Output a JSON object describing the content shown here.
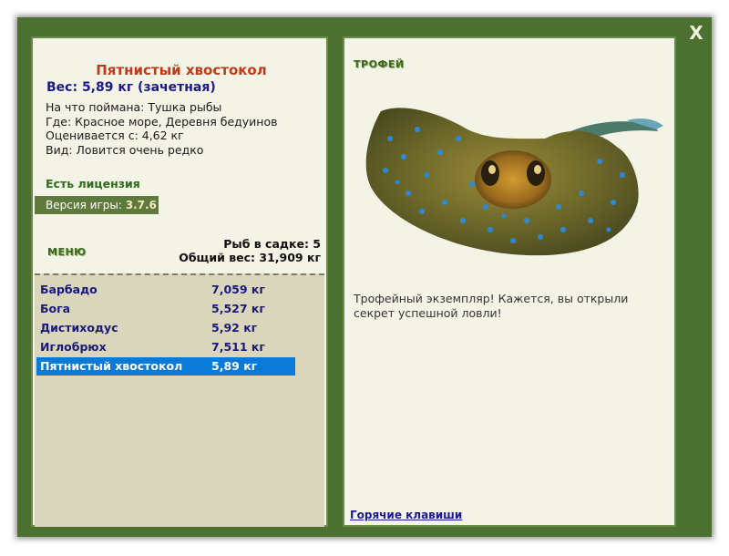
{
  "close_label": "X",
  "fish": {
    "name": "Пятнистый хвостокол",
    "weight": "Вес: 5,89 кг (зачетная)",
    "bait": "На что поймана: Тушка рыбы",
    "place": "Где: Красное море, Деревня бедуинов",
    "rating": "Оценивается с: 4,62 кг",
    "rarity": "Вид: Ловится очень редко"
  },
  "license": "Есть лицензия",
  "version": {
    "label": "Версия игры:",
    "value": "3.7.6"
  },
  "menu": {
    "title": "МЕНЮ",
    "cage_count": "Рыб в садке: 5",
    "total_weight": "Общий вес: 31,909 кг",
    "items": [
      {
        "name": "Барбадо",
        "weight": "7,059 кг"
      },
      {
        "name": "Бога",
        "weight": "5,527 кг"
      },
      {
        "name": "Дистиходус",
        "weight": "5,92 кг"
      },
      {
        "name": "Иглобрюх",
        "weight": "7,511 кг"
      },
      {
        "name": "Пятнистый хвостокол",
        "weight": "5,89 кг"
      }
    ]
  },
  "trophy": {
    "title": "ТРОФЕЙ",
    "description": "Трофейный экземпляр! Кажется, вы открыли секрет успешной ловли!",
    "image_icon": "stingray-image"
  },
  "hotkeys": "Горячие клавиши",
  "colors": {
    "window": "#4c7030",
    "panel": "#f4f4e6",
    "selected": "#0a7ad8"
  }
}
